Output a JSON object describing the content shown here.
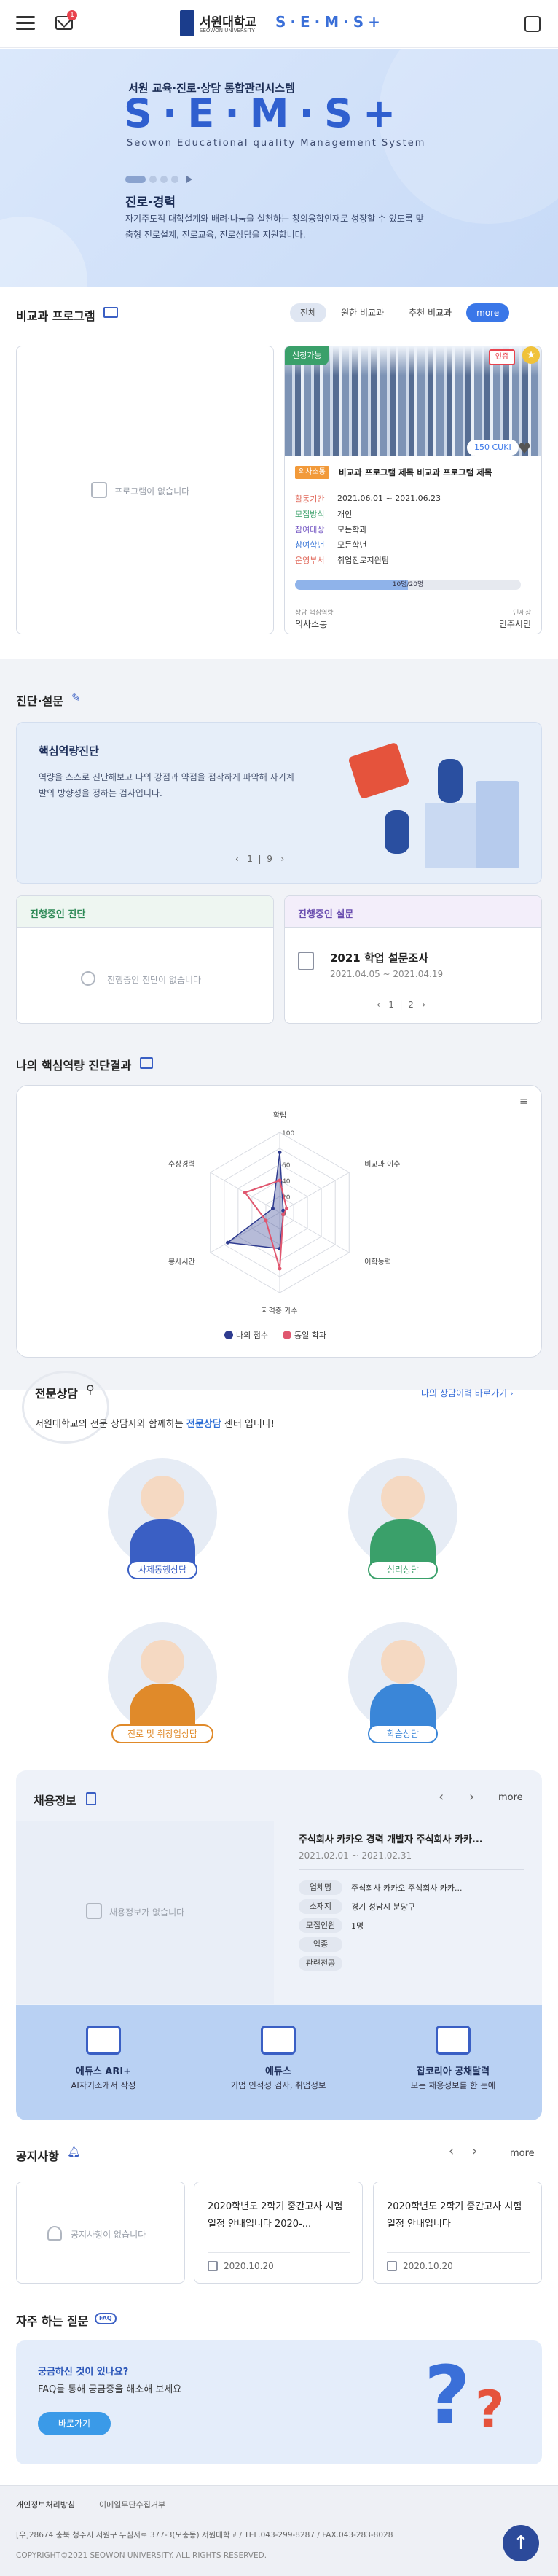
{
  "header": {
    "logo_name": "서원대학교",
    "logo_eng": "SEOWON UNIVERSITY",
    "logo_sems": "S·E·M·S+",
    "mail_badge": "1"
  },
  "hero": {
    "subtitle": "서원 교육·진로·상담 통합관리시스템",
    "brand": "S·E·M·S+",
    "english": "Seowon Educational quality Management System",
    "heading": "진로·경력",
    "desc": "자기주도적 대학설계와 배려·나눔을 실천하는 창의융합인재로 성장할 수 있도록 맞춤형 진로설계, 진로교육, 진로상담을 지원합니다."
  },
  "compare": {
    "title": "비교과 프로그램",
    "tabs": [
      "전체",
      "원한 비교과",
      "추천 비교과",
      "more"
    ],
    "empty": "프로그램이 없습니다",
    "program": {
      "status": "신청가능",
      "hot": "인증",
      "price": "150 CUKI",
      "category": "의사소통",
      "name": "비교과 프로그램 제목 비교과 프로그램 제목",
      "rows": [
        {
          "label": "활동기간",
          "value": "2021.06.01 ~ 2021.06.23",
          "color": "#e0685a"
        },
        {
          "label": "모집방식",
          "value": "개인",
          "color": "#3aa06a"
        },
        {
          "label": "참여대상",
          "value": "모든학과",
          "color": "#7b5fc6"
        },
        {
          "label": "참여학년",
          "value": "모든학년",
          "color": "#3f7ad8"
        },
        {
          "label": "운영부서",
          "value": "취업진로지원팀",
          "color": "#e0685a"
        }
      ],
      "progress": 0.5,
      "progress_text": "10명/20명",
      "foot_l_label": "상담 핵심역량",
      "foot_l_value": "의사소통",
      "foot_r_label": "인재상",
      "foot_r_value": "민주시민"
    }
  },
  "diagnosis": {
    "title": "진단·설문",
    "banner_title": "핵심역량진단",
    "banner_desc": "역량을 스스로 진단해보고 나의 강점과 약점을 점착하게 파악해 자기계발의 방향성을 정하는 검사입니다.",
    "pager_cur": "1",
    "pager_total": "9",
    "ongoing_diag_title": "진행중인 진단",
    "ongoing_diag_empty": "진행중인 진단이 없습니다",
    "ongoing_survey_title": "진행중인 설문",
    "survey_name": "2021 학업 설문조사",
    "survey_date": "2021.04.05 ~ 2021.04.19",
    "survey_cur": "1",
    "survey_total": "2"
  },
  "result": {
    "title": "나의 핵심역량 진단결과"
  },
  "chart_data": {
    "type": "radar",
    "axes": [
      "확립",
      "비교과 이수",
      "어학능력",
      "자격증 가수",
      "봉사시간",
      "수상경력"
    ],
    "ticks": [
      0,
      20,
      40,
      60,
      80,
      100
    ],
    "tick_labels": [
      "0",
      "20",
      "40",
      "60",
      "100"
    ],
    "series": [
      {
        "name": "나의 점수",
        "color": "#2e3b8f",
        "values": [
          75,
          5,
          5,
          45,
          75,
          10
        ]
      },
      {
        "name": "동일 학과",
        "color": "#e0566e",
        "values": [
          40,
          10,
          5,
          70,
          20,
          50
        ]
      }
    ],
    "legend": "bottom"
  },
  "counsel": {
    "title": "전문상담",
    "link": "나의 상담이력 바로가기",
    "intro_a": "서원대학교의 전문 상담사와 함께하는 ",
    "intro_b": "전문상담",
    "intro_c": " 센터 입니다!",
    "items": [
      {
        "label": "사제동행상담",
        "color": "#3a5fc4"
      },
      {
        "label": "심리상담",
        "color": "#3aa06a"
      },
      {
        "label": "진로 및 취창업상담",
        "color": "#e08a2a"
      },
      {
        "label": "학습상담",
        "color": "#3a86d8"
      }
    ]
  },
  "jobs": {
    "title": "채용정보",
    "more": "more",
    "empty": "채용정보가 없습니다",
    "company_title": "주식회사 카카오 경력 개발자 주식회사 카카...",
    "date": "2021.02.01 ~ 2021.02.31",
    "rows": [
      {
        "label": "업체명",
        "value": "주식회사 카카오 주식회사 카카..."
      },
      {
        "label": "소재지",
        "value": "경기 성남시 분당구"
      },
      {
        "label": "모집인원",
        "value": "1명"
      },
      {
        "label": "업종",
        "value": ""
      },
      {
        "label": "관련전공",
        "value": ""
      }
    ],
    "links": [
      {
        "title": "에듀스 ARI+",
        "desc": "AI자기소개서 작성"
      },
      {
        "title": "에듀스",
        "desc": "기업 인적성 검사, 취업정보"
      },
      {
        "title": "잡코리아 공채달력",
        "desc": "모든 채용정보를 한 눈에"
      }
    ]
  },
  "notices": {
    "title": "공지사항",
    "more": "more",
    "empty": "공지사항이 없습니다",
    "items": [
      {
        "title": "2020학년도 2학기 중간고사 시험 일정 안내입니다 2020-...",
        "date": "2020.10.20"
      },
      {
        "title": "2020학년도 2학기 중간고사 시험 일정 안내입니다",
        "date": "2020.10.20"
      }
    ]
  },
  "faq": {
    "title": "자주 하는 질문",
    "badge": "FAQ",
    "line1": "궁금하신 것이 있나요?",
    "line2": "FAQ를 통해 궁금증을 해소해 보세요",
    "button": "바로가기"
  },
  "footer": {
    "link1": "개인정보처리방침",
    "link2": "이메일무단수집거부",
    "address": "[우]28674 충북 청주시 서원구 무심서로 377-3(모충동) 서원대학교 / TEL.043-299-8287 / FAX.043-283-8028",
    "copyright": "COPYRIGHT©2021 SEOWON UNIVERSITY. ALL RIGHTS RESERVED."
  }
}
